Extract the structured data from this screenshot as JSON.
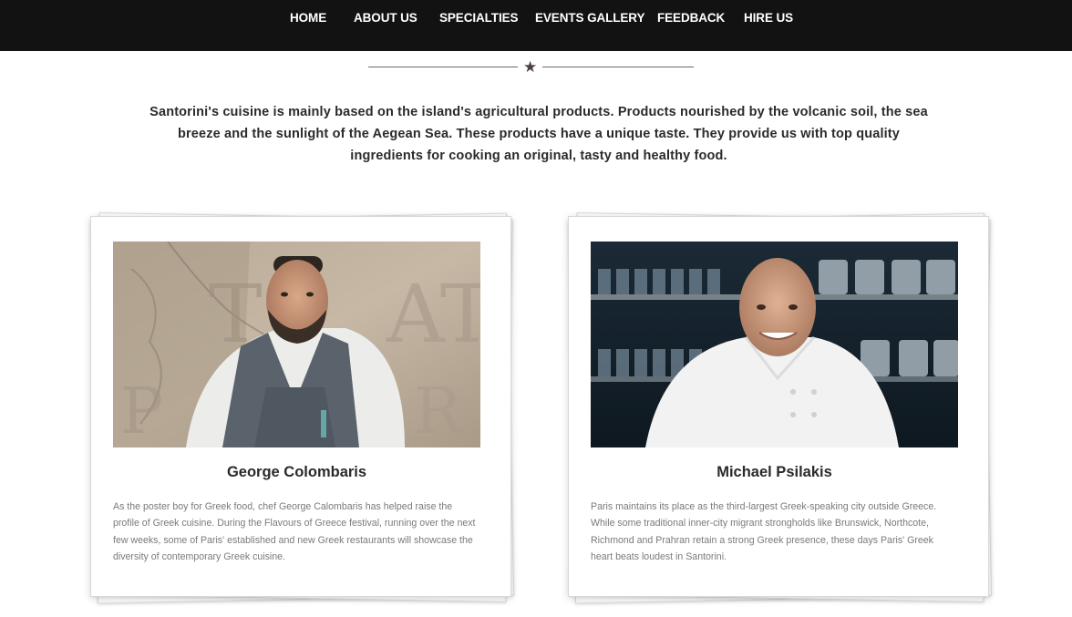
{
  "nav": {
    "items": [
      {
        "label": "HOME"
      },
      {
        "label": "ABOUT US"
      },
      {
        "label": "SPECIALTIES"
      },
      {
        "label": "EVENTS GALLERY"
      },
      {
        "label": "FEEDBACK"
      },
      {
        "label": "HIRE US"
      }
    ]
  },
  "divider": {
    "icon": "star-icon"
  },
  "intro": {
    "text": "Santorini's cuisine is mainly based on the island's agricultural products. Products nourished by the volcanic soil, the sea breeze and the sunlight of the Aegean Sea. These products have a unique taste. They provide us with top quality ingredients for cooking an original, tasty and healthy food."
  },
  "chefs": [
    {
      "name": "George Colombaris",
      "bio": "As the poster boy for Greek food, chef George Calombaris has helped raise the profile of Greek cuisine. During the Flavours of Greece festival, running over the next few weeks, some of Paris' established and new Greek restaurants will showcase the diversity of contemporary Greek cuisine."
    },
    {
      "name": "Michael Psilakis",
      "bio": "Paris maintains its place as the third-largest Greek-speaking city outside Greece. While some traditional inner-city migrant strongholds like Brunswick, Northcote, Richmond and Prahran retain a strong Greek presence, these days Paris' Greek heart beats loudest in Santorini."
    }
  ]
}
